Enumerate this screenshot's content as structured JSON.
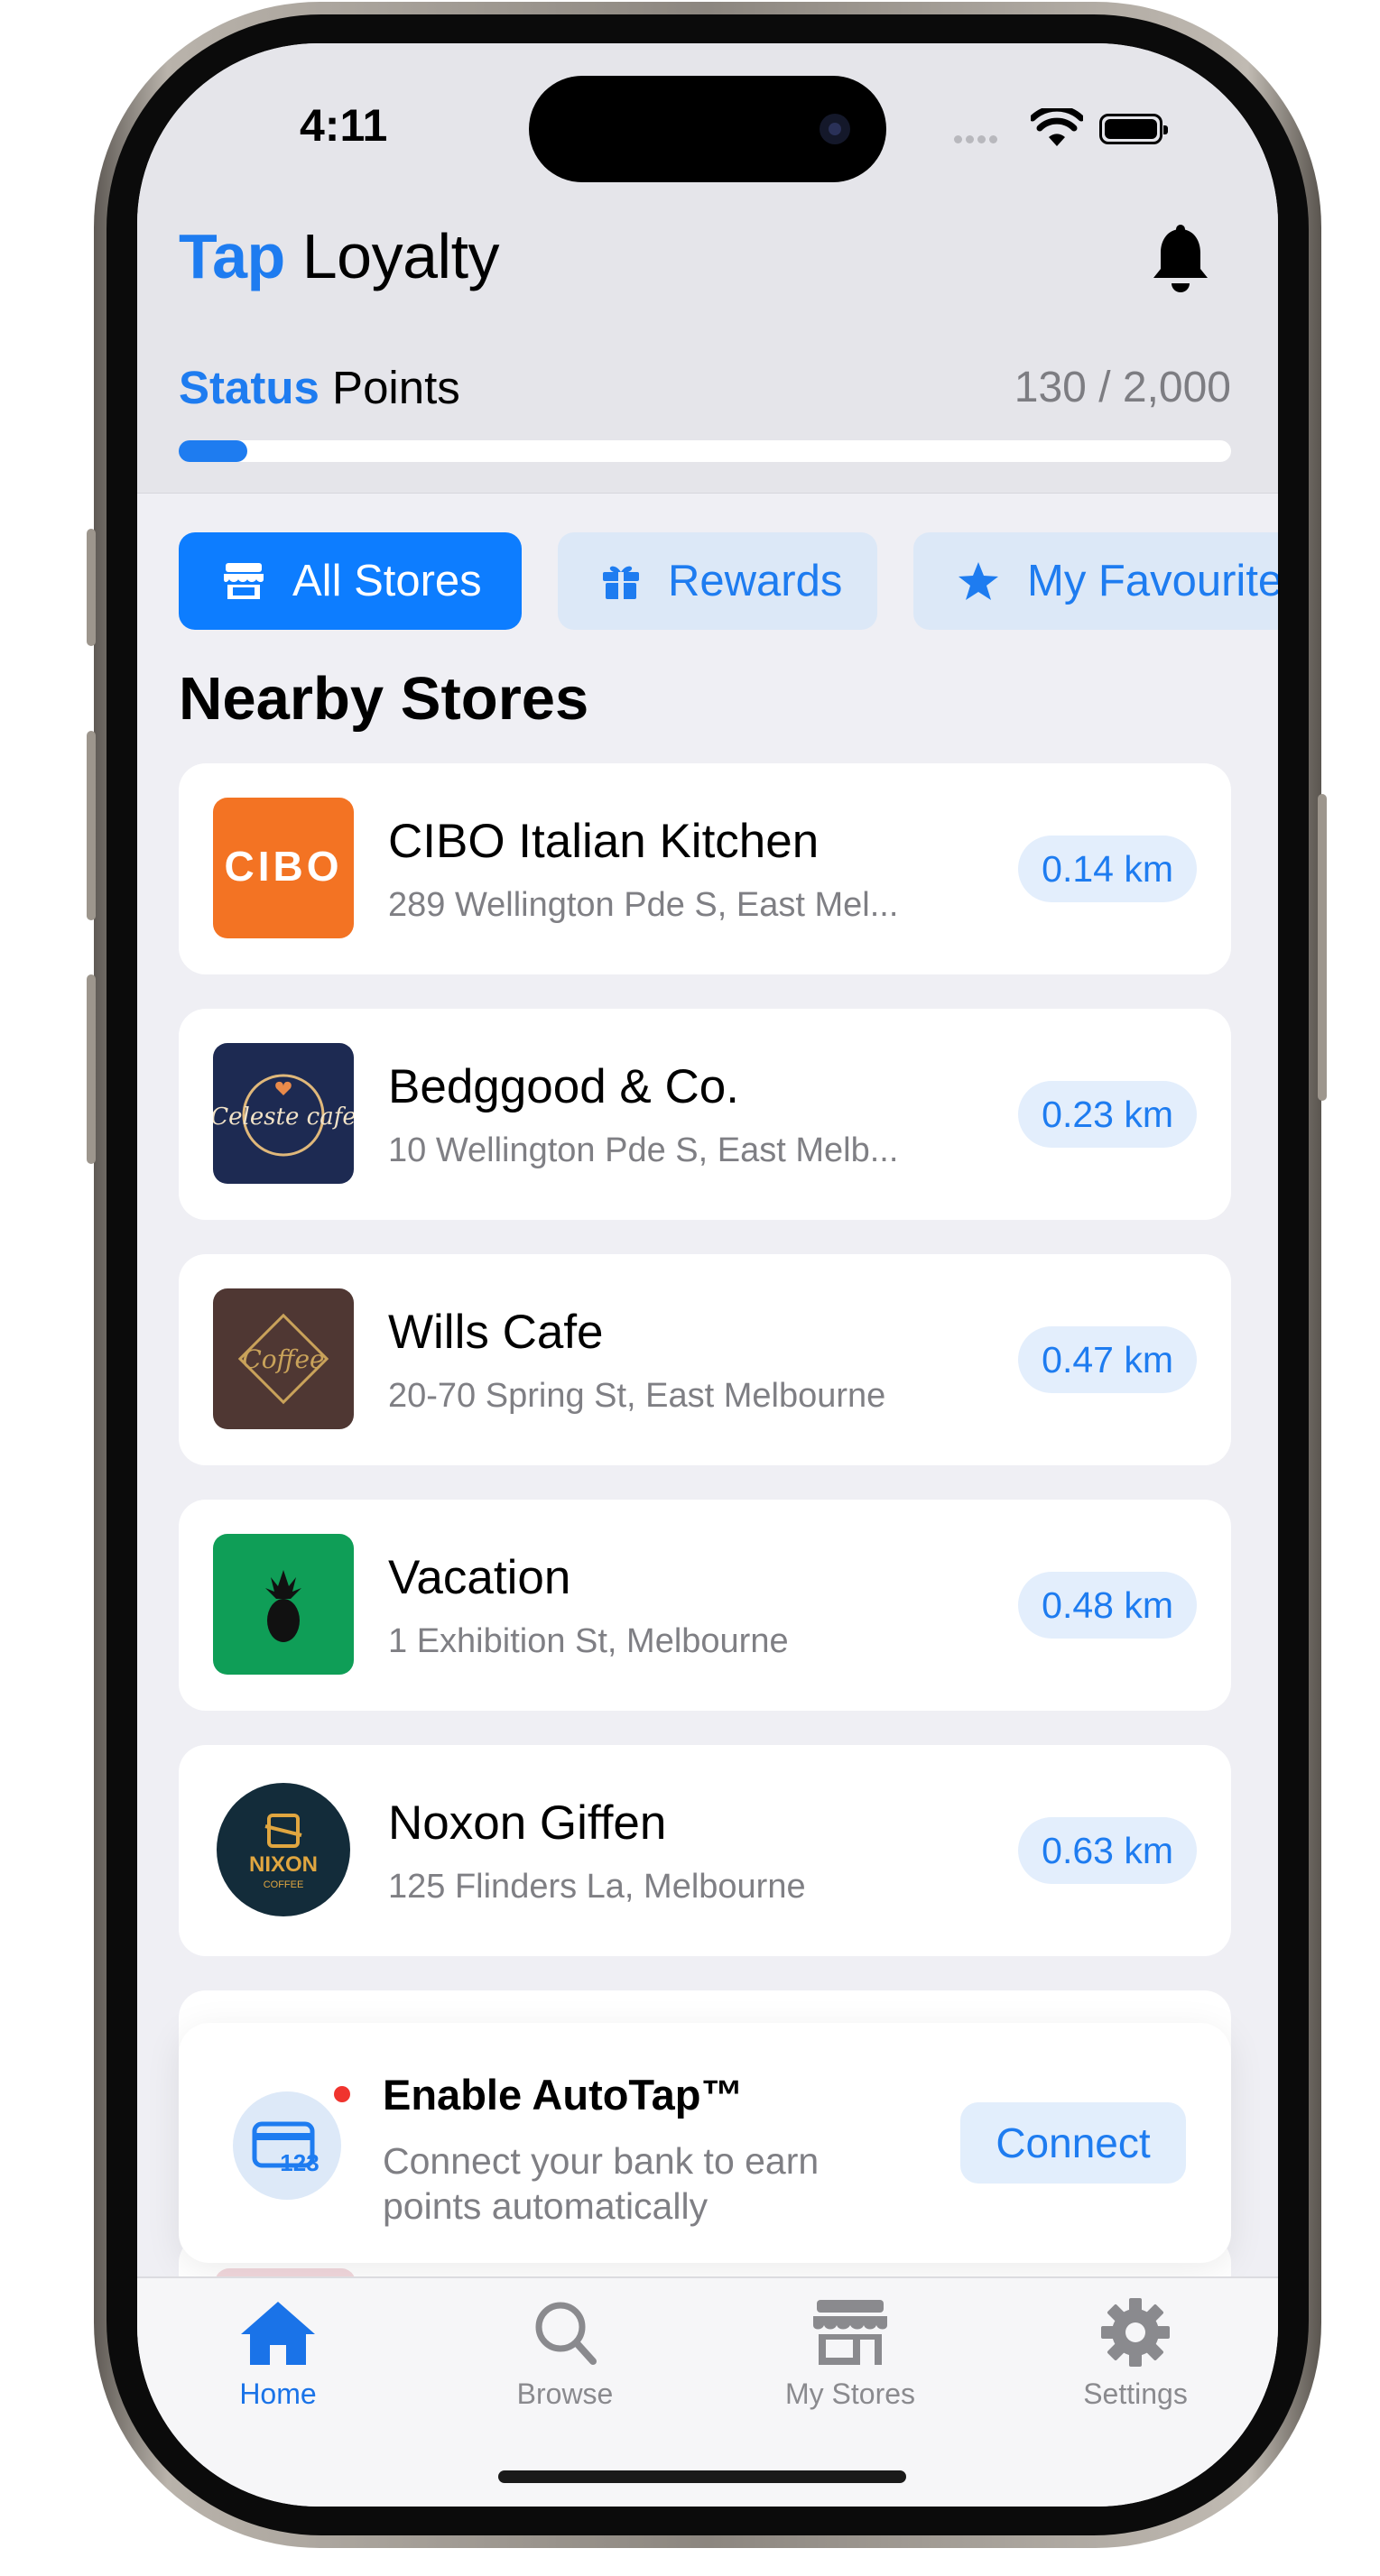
{
  "status_bar": {
    "time": "4:11"
  },
  "header": {
    "title_accent": "Tap",
    "title_rest": "Loyalty",
    "notification_icon": "bell-icon"
  },
  "status_points": {
    "label_accent": "Status",
    "label_rest": "Points",
    "value_text": "130 / 2,000",
    "current": 130,
    "target": 2000,
    "progress_fraction": 0.065,
    "accent_color": "#1e7cf0"
  },
  "tabs": [
    {
      "label": "All Stores",
      "icon": "storefront-icon",
      "active": true
    },
    {
      "label": "Rewards",
      "icon": "gift-icon",
      "active": false
    },
    {
      "label": "My Favourites",
      "icon": "star-icon",
      "active": false
    }
  ],
  "section_title": "Nearby Stores",
  "stores": [
    {
      "name": "CIBO Italian Kitchen",
      "address": "289 Wellington Pde S, East Mel...",
      "distance": "0.14 km",
      "logo_text": "CIBO"
    },
    {
      "name": "Bedggood & Co.",
      "address": "10 Wellington Pde S, East Melb...",
      "distance": "0.23 km",
      "logo_text": "Celeste cafe"
    },
    {
      "name": "Wills Cafe",
      "address": "20-70 Spring St, East Melbourne",
      "distance": "0.47 km",
      "logo_text": "Coffee"
    },
    {
      "name": "Vacation",
      "address": "1 Exhibition St, Melbourne",
      "distance": "0.48 km",
      "logo_text": ""
    },
    {
      "name": "Noxon Giffen",
      "address": "125 Flinders La, Melbourne",
      "distance": "0.63 km",
      "logo_text": "NIXON COFFEE"
    }
  ],
  "autotap": {
    "title": "Enable AutoTap™",
    "description": "Connect your bank to earn points automatically",
    "button": "Connect",
    "icon": "card-icon",
    "icon_text": "123"
  },
  "tab_bar": [
    {
      "label": "Home",
      "icon": "home-icon",
      "active": true
    },
    {
      "label": "Browse",
      "icon": "magnifier-icon",
      "active": false
    },
    {
      "label": "My Stores",
      "icon": "store-icon",
      "active": false
    },
    {
      "label": "Settings",
      "icon": "gear-icon",
      "active": false
    }
  ]
}
